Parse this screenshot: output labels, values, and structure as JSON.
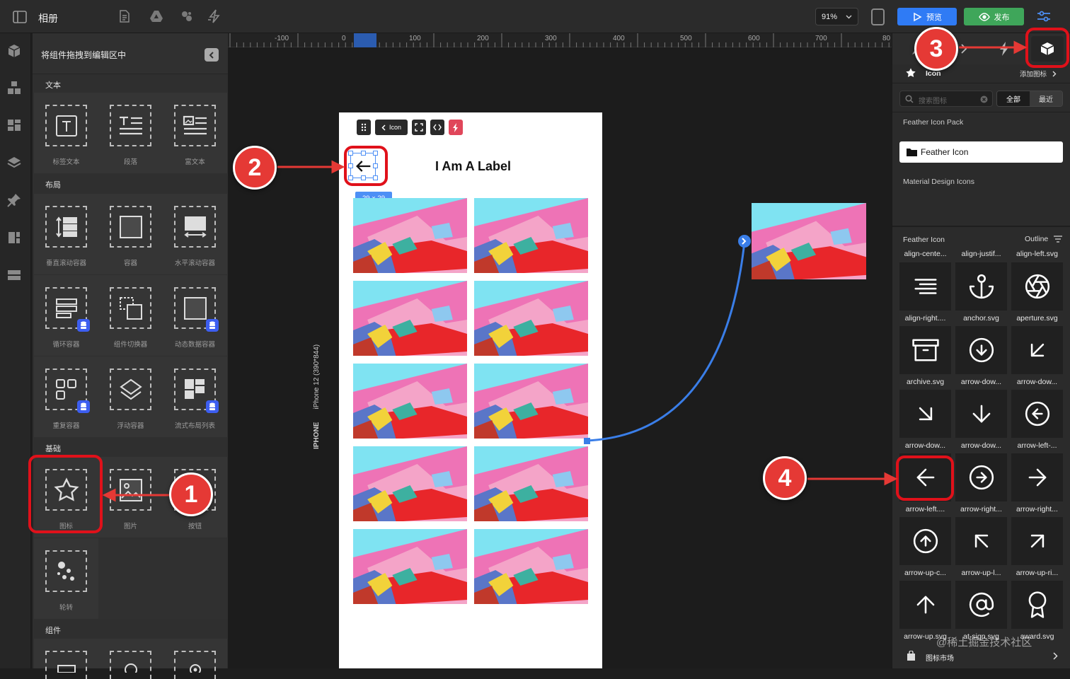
{
  "toolbar": {
    "title": "相册",
    "zoom": "91%",
    "preview_label": "预览",
    "publish_label": "发布",
    "accent": "#2f7bf5",
    "publish_color": "#3fa65a"
  },
  "rail": [
    "package-icon",
    "boxes-icon",
    "layout-icon",
    "layers-icon",
    "pin-icon",
    "pages-icon",
    "grid-icon"
  ],
  "left_panel": {
    "header": "将组件拖拽到编辑区中",
    "sections": [
      {
        "title": "文本",
        "items": [
          "标签文本",
          "段落",
          "富文本"
        ]
      },
      {
        "title": "布局",
        "items": [
          "垂直滚动容器",
          "容器",
          "水平滚动容器",
          "循环容器",
          "组件切换器",
          "动态数据容器",
          "重复容器",
          "浮动容器",
          "流式布局列表"
        ]
      },
      {
        "title": "基础",
        "items": [
          "图标",
          "图片",
          "按钮",
          "轮转"
        ]
      },
      {
        "title": "组件",
        "items": []
      }
    ]
  },
  "canvas": {
    "ruler_labels": [
      "-100",
      "0",
      "100",
      "200",
      "300",
      "400",
      "500",
      "600",
      "700",
      "80"
    ],
    "device_label_bold": "IPHONE",
    "device_label": "iPhone 12 (390*844)",
    "phone": {
      "back_label": "Icon",
      "label_text": "I Am A Label",
      "size_badge": "29 × 29",
      "grid_count": 10
    }
  },
  "right_panel": {
    "tab_icon_label": "Icon",
    "add_icon": "添加图标",
    "search_placeholder": "搜索图标",
    "filter_all": "全部",
    "filter_recent": "最近",
    "pack_title": "Feather Icon Pack",
    "pack_selected": "Feather Icon",
    "material": "Material Design Icons",
    "list_title": "Feather Icon",
    "style": "Outline",
    "top_labels": [
      "align-cente...",
      "align-justif...",
      "align-left.svg"
    ],
    "icons": [
      {
        "label": "align-right....",
        "icon": "align-right-icon"
      },
      {
        "label": "anchor.svg",
        "icon": "anchor-icon"
      },
      {
        "label": "aperture.svg",
        "icon": "aperture-icon"
      },
      {
        "label": "archive.svg",
        "icon": "archive-icon"
      },
      {
        "label": "arrow-dow...",
        "icon": "arrow-down-circle-icon"
      },
      {
        "label": "arrow-dow...",
        "icon": "arrow-down-left-icon"
      },
      {
        "label": "arrow-dow...",
        "icon": "arrow-down-right-icon"
      },
      {
        "label": "arrow-dow...",
        "icon": "arrow-down-icon"
      },
      {
        "label": "arrow-left-...",
        "icon": "arrow-left-circle-icon"
      },
      {
        "label": "arrow-left....",
        "icon": "arrow-left-icon"
      },
      {
        "label": "arrow-right...",
        "icon": "arrow-right-circle-icon"
      },
      {
        "label": "arrow-right...",
        "icon": "arrow-right-icon"
      },
      {
        "label": "arrow-up-c...",
        "icon": "arrow-up-circle-icon"
      },
      {
        "label": "arrow-up-l...",
        "icon": "arrow-up-left-icon"
      },
      {
        "label": "arrow-up-ri...",
        "icon": "arrow-up-right-icon"
      },
      {
        "label": "arrow-up.svg",
        "icon": "arrow-up-icon"
      },
      {
        "label": "at-sign.svg",
        "icon": "at-sign-icon"
      },
      {
        "label": "award.svg",
        "icon": "award-icon"
      }
    ],
    "market": "图标市场"
  },
  "annotations": {
    "step1": "1",
    "step2": "2",
    "step3": "3",
    "step4": "4",
    "color": "#e53935"
  },
  "watermark": "@稀土掘金技术社区"
}
